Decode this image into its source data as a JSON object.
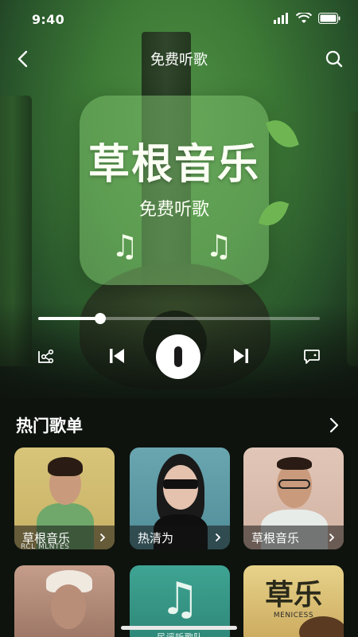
{
  "status_bar": {
    "time": "9:40"
  },
  "nav": {
    "title": "免费听歌"
  },
  "album": {
    "title": "草根音乐",
    "subtitle": "免费听歌",
    "notes": "♫ ♫"
  },
  "player": {
    "progress_fraction": 0.22
  },
  "hot_playlists": {
    "heading": "热门歌单",
    "cards": [
      {
        "label": "草根音乐",
        "footer": "RCL MLNTES"
      },
      {
        "label": "热清为"
      },
      {
        "label": "草根音乐"
      },
      {},
      {
        "footer": "民谣听歌队"
      },
      {
        "art_text": "草乐",
        "footer": "MENICESS"
      }
    ]
  },
  "colors": {
    "accent_green": "#3d7a36",
    "play_button": "#ffffff",
    "background": "#0e130e"
  }
}
